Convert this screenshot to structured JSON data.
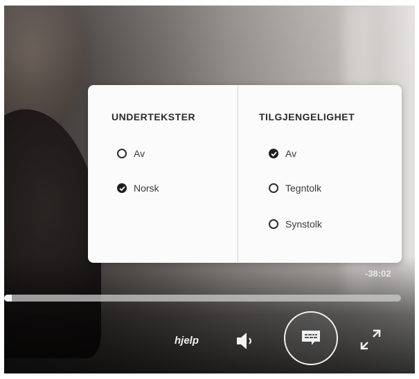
{
  "video": {
    "remaining_time": "-38:02",
    "progress_fraction": 0.02
  },
  "menu": {
    "subtitles": {
      "heading": "UNDERTEKSTER",
      "options": [
        {
          "label": "Av",
          "selected": false
        },
        {
          "label": "Norsk",
          "selected": true
        }
      ]
    },
    "accessibility": {
      "heading": "TILGJENGELIGHET",
      "options": [
        {
          "label": "Av",
          "selected": true
        },
        {
          "label": "Tegntolk",
          "selected": false
        },
        {
          "label": "Synstolk",
          "selected": false
        }
      ]
    }
  },
  "controls": {
    "help_label": "hjelp",
    "icons": {
      "volume": "speaker-icon",
      "subtitles": "subtitles-icon",
      "fullscreen": "expand-icon"
    }
  },
  "colors": {
    "menu_background": "#fbfbfb",
    "text_dark": "#2b2b2b",
    "control_white": "#f2f2f2"
  }
}
